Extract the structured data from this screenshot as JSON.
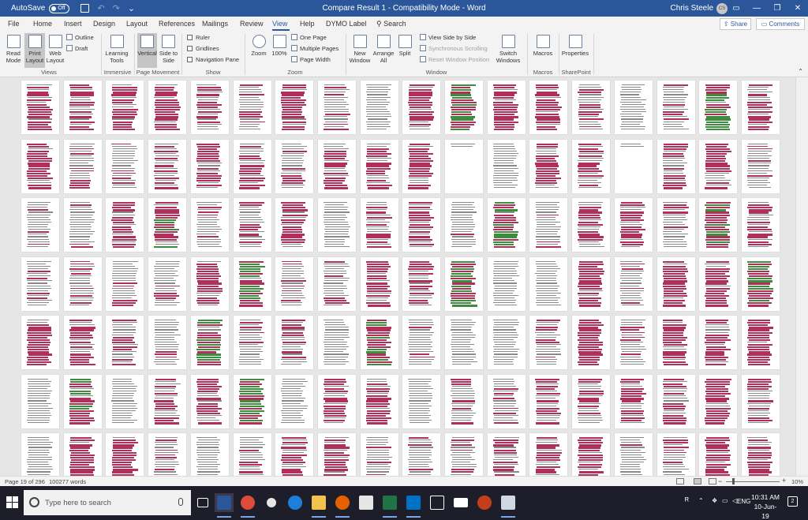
{
  "titlebar": {
    "autosave_label": "AutoSave",
    "autosave_state": "Off",
    "title": "Compare Result 1  -  Compatibility Mode  -  Word",
    "user_name": "Chris Steele",
    "user_initials": "CS"
  },
  "tabs": [
    "File",
    "Home",
    "Insert",
    "Design",
    "Layout",
    "References",
    "Mailings",
    "Review",
    "View",
    "Help",
    "DYMO Label"
  ],
  "active_tab": "View",
  "search_label": "Search",
  "share_label": "Share",
  "comments_label": "Comments",
  "ribbon": {
    "views": {
      "read_mode": "Read Mode",
      "print_layout": "Print Layout",
      "web_layout": "Web Layout",
      "outline": "Outline",
      "draft": "Draft",
      "group": "Views"
    },
    "immersive": {
      "learning_tools": "Learning Tools",
      "group": "Immersive"
    },
    "page_movement": {
      "vertical": "Vertical",
      "side_to_side": "Side to Side",
      "group": "Page Movement"
    },
    "show": {
      "ruler": "Ruler",
      "gridlines": "Gridlines",
      "navigation_pane": "Navigation Pane",
      "group": "Show"
    },
    "zoom": {
      "zoom": "Zoom",
      "hundred": "100%",
      "one_page": "One Page",
      "multiple_pages": "Multiple Pages",
      "page_width": "Page Width",
      "group": "Zoom"
    },
    "window": {
      "new_window": "New Window",
      "arrange_all": "Arrange All",
      "split": "Split",
      "view_side_by_side": "View Side by Side",
      "synchronous_scrolling": "Synchronous Scrolling",
      "reset_window_position": "Reset Window Position",
      "switch_windows": "Switch Windows",
      "group": "Window"
    },
    "macros": {
      "macros": "Macros",
      "group": "Macros"
    },
    "sharepoint": {
      "properties": "Properties",
      "group": "SharePoint"
    }
  },
  "statusbar": {
    "page": "Page 19 of 296",
    "words": "100277 words",
    "zoom_percent": "10%"
  },
  "taskbar": {
    "search_placeholder": "Type here to search",
    "time": "10:31 AM",
    "date": "10-Jun-19",
    "language": "ENG",
    "notifications": "2"
  },
  "colors": {
    "word_blue": "#2b579a",
    "markup_red": "#b0305a",
    "markup_green": "#3e8c3e",
    "taskbar_bg": "#1e1e2b"
  }
}
